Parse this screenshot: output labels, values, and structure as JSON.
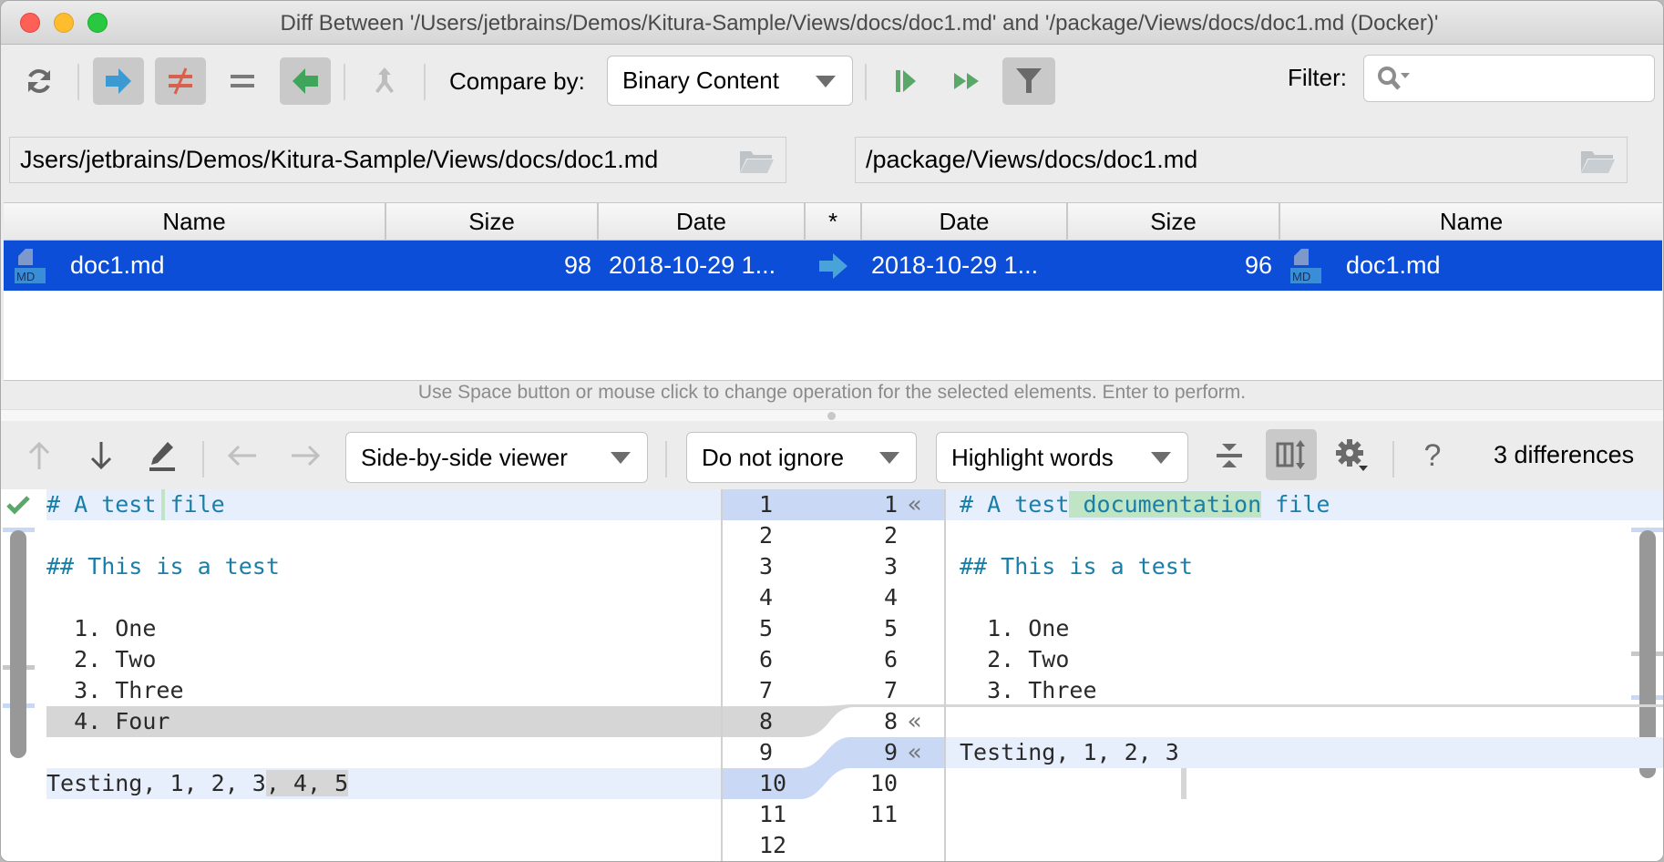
{
  "window": {
    "title": "Diff Between '/Users/jetbrains/Demos/Kitura-Sample/Views/docs/doc1.md' and '/package/Views/docs/doc1.md (Docker)'"
  },
  "toolbar": {
    "refresh_icon": "refresh-icon",
    "copy_right_icon": "arrow-right-icon",
    "not_equal_icon": "not-equal-icon",
    "equal_icon": "equal-icon",
    "copy_left_icon": "arrow-left-icon",
    "merge_icon": "merge-icon",
    "compare_by_label": "Compare by:",
    "compare_by_value": "Binary Content",
    "sync_selected_icon": "synchronize-selected-icon",
    "sync_all_icon": "synchronize-all-icon",
    "filter_icon": "filter-icon",
    "filter_label": "Filter:",
    "filter_value": "",
    "filter_search_icon": "search-icon"
  },
  "paths": {
    "left": "Jsers/jetbrains/Demos/Kitura-Sample/Views/docs/doc1.md",
    "right": "/package/Views/docs/doc1.md"
  },
  "table": {
    "columns": [
      "Name",
      "Size",
      "Date",
      "*",
      "Date",
      "Size",
      "Name"
    ],
    "rows": [
      {
        "left_icon": "MD",
        "left_name": "doc1.md",
        "left_size": "98",
        "left_date": "2018-10-29 1...",
        "operation": "copy-right",
        "right_date": "2018-10-29 1...",
        "right_size": "96",
        "right_icon": "MD",
        "right_name": "doc1.md",
        "selected": true
      }
    ]
  },
  "hint": "Use Space button or mouse click to change operation for the selected elements. Enter to perform.",
  "diff_toolbar": {
    "viewer_value": "Side-by-side viewer",
    "ignore_value": "Do not ignore",
    "highlight_value": "Highlight words",
    "differences_count": "3 differences",
    "help_label": "?"
  },
  "left_editor": {
    "lines": [
      {
        "n": "1",
        "text": "# A test file",
        "type": "heading",
        "bg": "mod"
      },
      {
        "n": "2",
        "text": "",
        "type": "plain",
        "bg": ""
      },
      {
        "n": "3",
        "text": "## This is a test",
        "type": "heading",
        "bg": ""
      },
      {
        "n": "4",
        "text": "",
        "type": "plain",
        "bg": ""
      },
      {
        "n": "5",
        "text": "  1. One",
        "type": "plain",
        "bg": ""
      },
      {
        "n": "6",
        "text": "  2. Two",
        "type": "plain",
        "bg": ""
      },
      {
        "n": "7",
        "text": "  3. Three",
        "type": "plain",
        "bg": ""
      },
      {
        "n": "8",
        "text": "  4. Four",
        "type": "plain",
        "bg": "del"
      },
      {
        "n": "9",
        "text": "",
        "type": "plain",
        "bg": ""
      },
      {
        "n": "10",
        "text": "Testing, 1, 2, 3",
        "extra": ", 4, 5",
        "type": "plain",
        "bg": "mod"
      },
      {
        "n": "11",
        "text": "",
        "type": "plain",
        "bg": ""
      },
      {
        "n": "12",
        "text": "",
        "type": "plain",
        "bg": ""
      }
    ]
  },
  "right_editor": {
    "lines": [
      {
        "n": "1",
        "text": "# A test",
        "inserted": " documentation",
        "rest": " file",
        "type": "heading",
        "bg": "mod",
        "chevron": true
      },
      {
        "n": "2",
        "text": "",
        "type": "plain",
        "bg": ""
      },
      {
        "n": "3",
        "text": "## This is a test",
        "type": "heading",
        "bg": ""
      },
      {
        "n": "4",
        "text": "",
        "type": "plain",
        "bg": ""
      },
      {
        "n": "5",
        "text": "  1. One",
        "type": "plain",
        "bg": ""
      },
      {
        "n": "6",
        "text": "  2. Two",
        "type": "plain",
        "bg": ""
      },
      {
        "n": "7",
        "text": "  3. Three",
        "type": "plain",
        "bg": ""
      },
      {
        "n": "8",
        "text": "",
        "type": "plain",
        "bg": "",
        "chevron": true
      },
      {
        "n": "9",
        "text": "Testing, 1, 2, 3",
        "type": "plain",
        "bg": "mod",
        "chevron": true
      },
      {
        "n": "10",
        "text": "",
        "type": "plain",
        "bg": ""
      },
      {
        "n": "11",
        "text": "",
        "type": "plain",
        "bg": ""
      }
    ]
  },
  "gutter": {
    "chevron_glyph": "«"
  },
  "colors": {
    "selection": "#0d4ed8",
    "modified_line": "#e8effc",
    "modified_gutter": "#c9d8f5",
    "deleted_line": "#d6d6d6",
    "inserted_word": "#bfe5c4",
    "heading_text": "#1a7fa8",
    "check_green": "#59a869",
    "arrow_blue": "#3c9ad3",
    "arrow_green": "#3fa55b"
  }
}
